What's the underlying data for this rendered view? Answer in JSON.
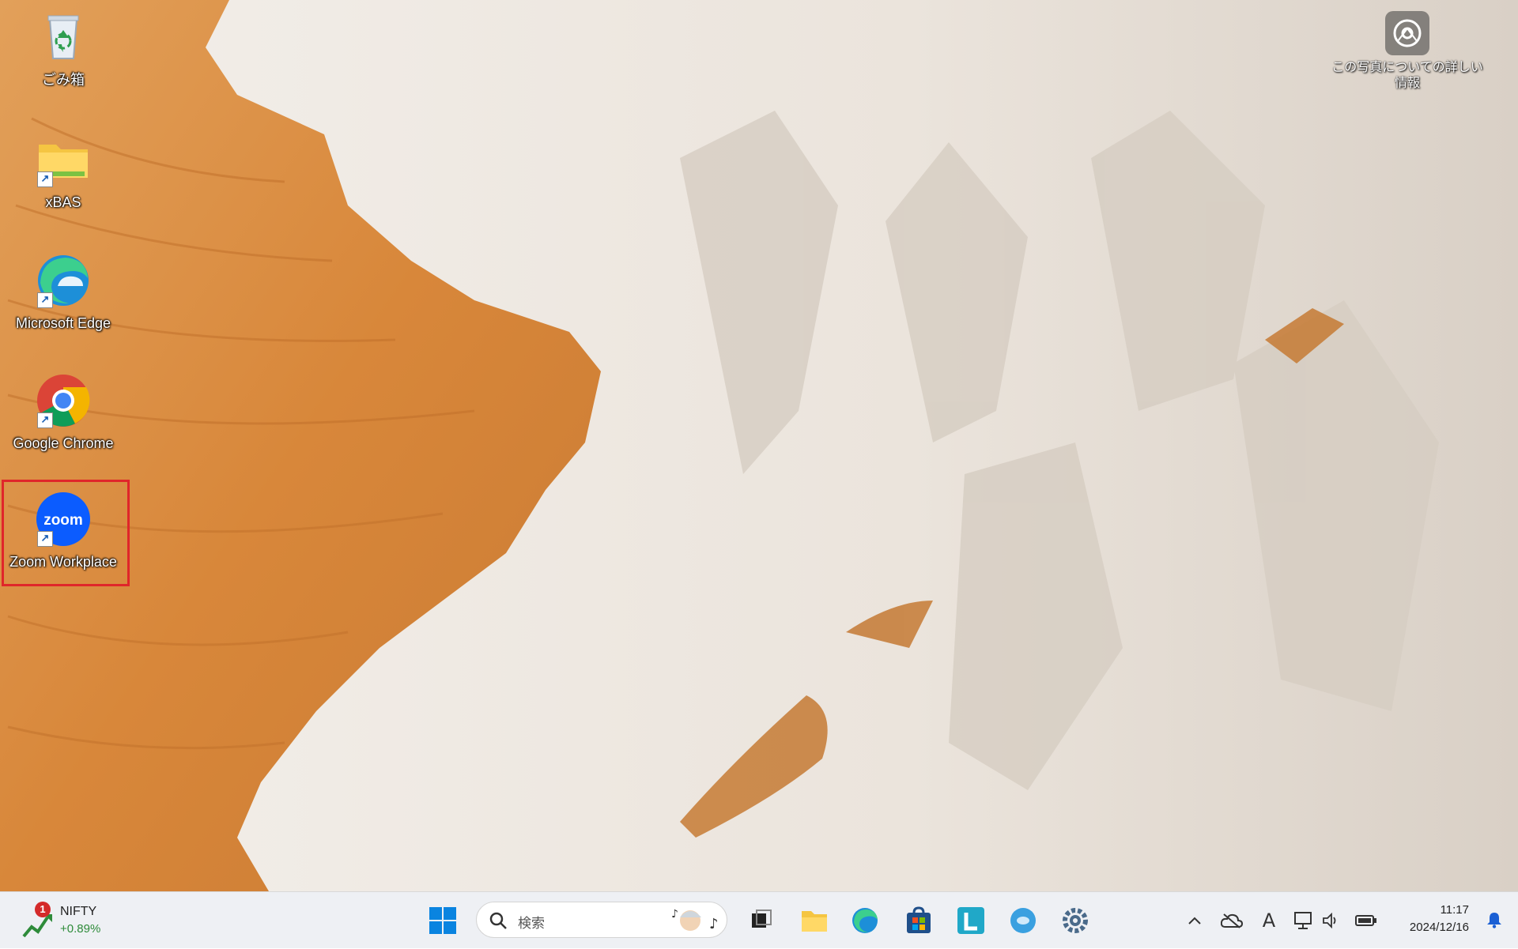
{
  "desktop": {
    "icons": [
      {
        "label": "ごみ箱",
        "icon": "recycle-bin-icon"
      },
      {
        "label": "xBAS",
        "icon": "folder-icon"
      },
      {
        "label": "Microsoft Edge",
        "icon": "edge-icon"
      },
      {
        "label": "Google Chrome",
        "icon": "chrome-icon"
      },
      {
        "label": "Zoom Workplace",
        "icon": "zoom-icon",
        "logo_text": "zoom"
      }
    ],
    "photo_info": {
      "text": "この写真についての詳しい情報",
      "icon": "camera-info-icon"
    }
  },
  "taskbar": {
    "widget": {
      "ticker": "NIFTY",
      "change": "+0.89%",
      "badge": "1",
      "change_color": "#2e8b3a"
    },
    "search": {
      "placeholder": "検索"
    },
    "pinned": [
      "file-explorer-icon",
      "edge-icon",
      "store-icon",
      "lens-l-icon",
      "cortana-icon",
      "settings-icon"
    ],
    "tray": [
      "chevron-up-icon",
      "cloud-icon",
      "ime-icon",
      "display-icon",
      "volume-icon",
      "battery-icon"
    ],
    "ime_label": "A",
    "clock": {
      "time": "11:17",
      "date": "2024/12/16"
    }
  },
  "colors": {
    "highlight": "#e0262a",
    "taskbar_bg": "#eef0f4",
    "sand": "#d98a3c"
  }
}
